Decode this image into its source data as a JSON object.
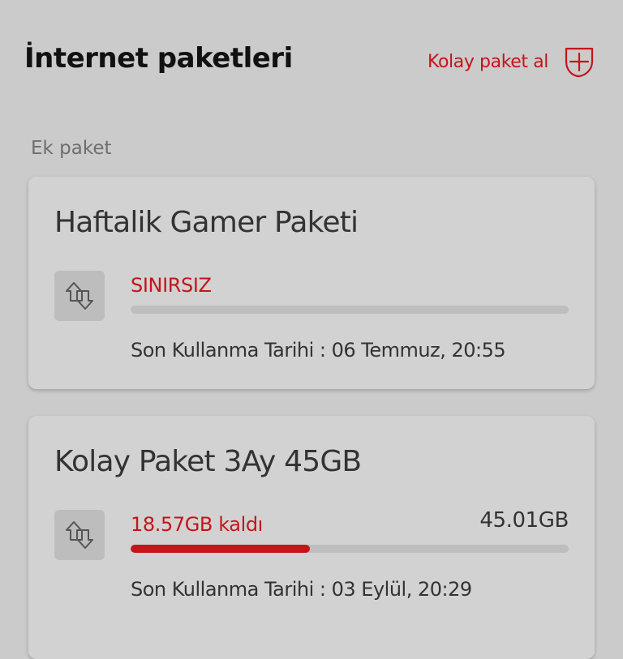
{
  "header": {
    "title": "İnternet paketleri",
    "easy_buy_label": "Kolay paket al",
    "easy_buy_icon": "plus-shield-icon"
  },
  "section": {
    "label": "Ek paket"
  },
  "packages": [
    {
      "name": "Haftalik Gamer Paketi",
      "icon": "data-transfer-icon",
      "remaining_label": "SINIRSIZ",
      "total_label": "",
      "usage_fraction_remaining": 0,
      "expiry": "Son Kullanma Tarihi : 06 Temmuz, 20:55"
    },
    {
      "name": "Kolay Paket 3Ay 45GB",
      "icon": "data-transfer-icon",
      "remaining_label": "18.57GB kaldı",
      "total_label": "45.01GB",
      "usage_fraction_remaining": 0.41,
      "expiry": "Son Kullanma Tarihi : 03 Eylül, 20:29"
    }
  ],
  "colors": {
    "accent": "#c4151b",
    "background": "#cbcbcb",
    "card": "#d2d2d2",
    "progress_track": "#bebebe"
  }
}
